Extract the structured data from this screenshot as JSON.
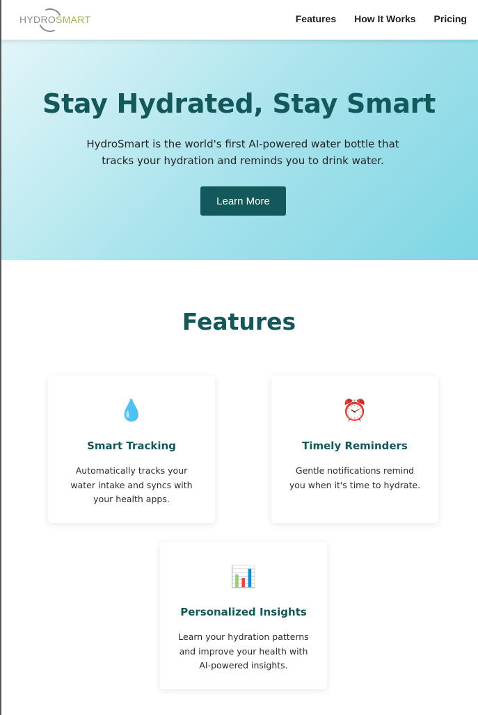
{
  "header": {
    "logo": {
      "part1": "HYDRO",
      "part2": "SMART"
    },
    "nav": [
      "Features",
      "How It Works",
      "Pricing"
    ]
  },
  "hero": {
    "title": "Stay Hydrated, Stay Smart",
    "subtitle": "HydroSmart is the world's first AI-powered water bottle that tracks your hydration and reminds you to drink water.",
    "button": "Learn More"
  },
  "features": {
    "title": "Features",
    "cards": [
      {
        "icon": "💧",
        "icon_name": "water-drop-icon",
        "title": "Smart Tracking",
        "text": "Automatically tracks your water intake and syncs with your health apps."
      },
      {
        "icon": "⏰",
        "icon_name": "alarm-clock-icon",
        "title": "Timely Reminders",
        "text": "Gentle notifications remind you when it's time to hydrate."
      },
      {
        "icon": "📊",
        "icon_name": "bar-chart-icon",
        "title": "Personalized Insights",
        "text": "Learn your hydration patterns and improve your health with AI-powered insights."
      }
    ]
  },
  "colors": {
    "primary": "#13595b",
    "logo_gray": "#8a8a8a",
    "logo_green": "#9bb83a",
    "hero_gradient_start": "#e2f6f9",
    "hero_gradient_end": "#7ed6e4"
  }
}
